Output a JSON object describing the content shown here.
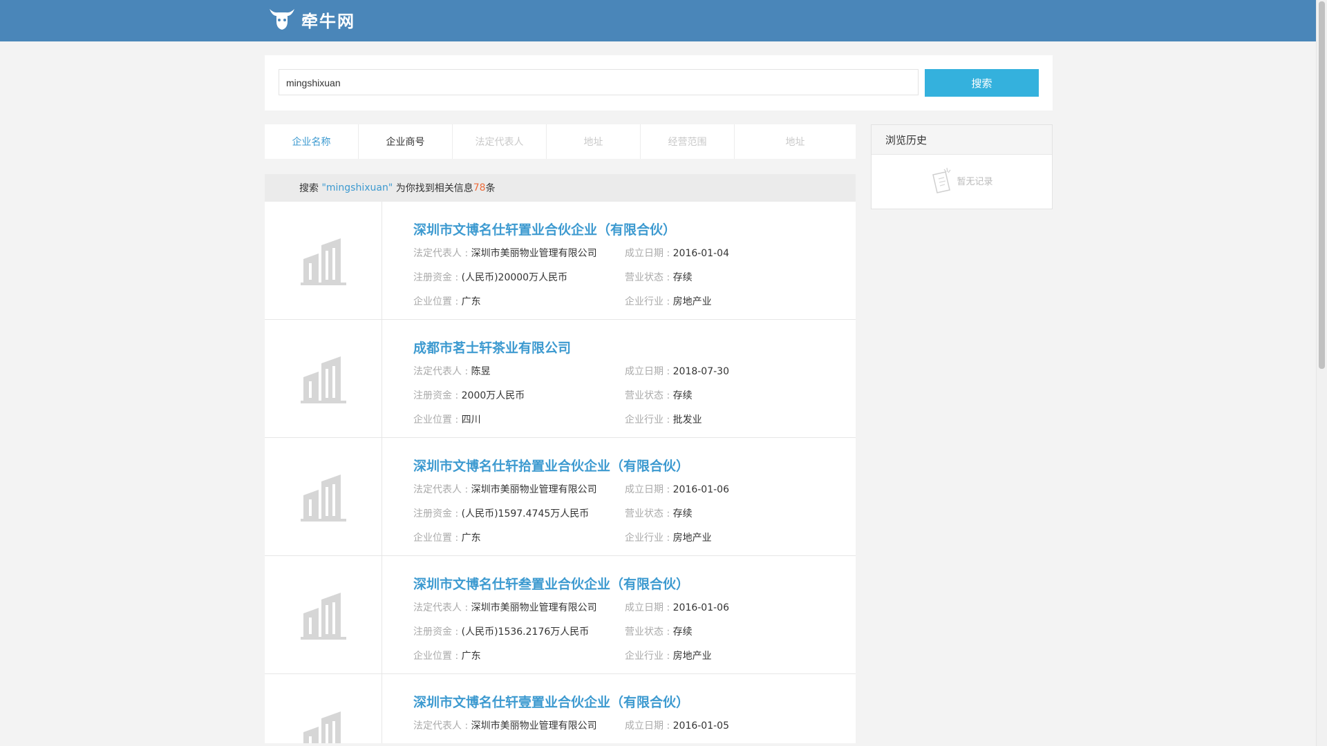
{
  "header": {
    "site_name": "牵牛网",
    "brand_color": "#4a86b9"
  },
  "search": {
    "value": "mingshixuan",
    "button_label": "搜索"
  },
  "tabs": [
    {
      "label": "企业名称",
      "state": "active"
    },
    {
      "label": "企业商号",
      "state": "normal"
    },
    {
      "label": "法定代表人",
      "state": "disabled"
    },
    {
      "label": "地址",
      "state": "disabled"
    },
    {
      "label": "经营范围",
      "state": "disabled"
    },
    {
      "label": "地址",
      "state": "disabled"
    }
  ],
  "result_summary": {
    "prefix": "搜索",
    "keyword": "\"mingshixuan\"",
    "middle": "为你找到相关信息",
    "count": "78",
    "suffix": "条"
  },
  "labels": {
    "legal_rep": "法定代表人 :",
    "founded": "成立日期 :",
    "capital": "注册资金 :",
    "status": "营业状态 :",
    "location": "企业位置 :",
    "industry": "企业行业 :"
  },
  "results": [
    {
      "name": "深圳市文博名仕轩置业合伙企业（有限合伙）",
      "legal_rep": "深圳市美丽物业管理有限公司",
      "founded": "2016-01-04",
      "capital": "(人民币)20000万人民币",
      "status": "存续",
      "location": "广东",
      "industry": "房地产业"
    },
    {
      "name": "成都市茗士轩茶业有限公司",
      "legal_rep": "陈昱",
      "founded": "2018-07-30",
      "capital": "2000万人民币",
      "status": "存续",
      "location": "四川",
      "industry": "批发业"
    },
    {
      "name": "深圳市文博名仕轩拾置业合伙企业（有限合伙）",
      "legal_rep": "深圳市美丽物业管理有限公司",
      "founded": "2016-01-06",
      "capital": "(人民币)1597.4745万人民币",
      "status": "存续",
      "location": "广东",
      "industry": "房地产业"
    },
    {
      "name": "深圳市文博名仕轩叁置业合伙企业（有限合伙）",
      "legal_rep": "深圳市美丽物业管理有限公司",
      "founded": "2016-01-06",
      "capital": "(人民币)1536.2176万人民币",
      "status": "存续",
      "location": "广东",
      "industry": "房地产业"
    },
    {
      "name": "深圳市文博名仕轩壹置业合伙企业（有限合伙）",
      "legal_rep": "深圳市美丽物业管理有限公司",
      "founded": "2016-01-05",
      "capital": "",
      "status": "",
      "location": "",
      "industry": ""
    }
  ],
  "history": {
    "title": "浏览历史",
    "empty_text": "暂无记录"
  }
}
